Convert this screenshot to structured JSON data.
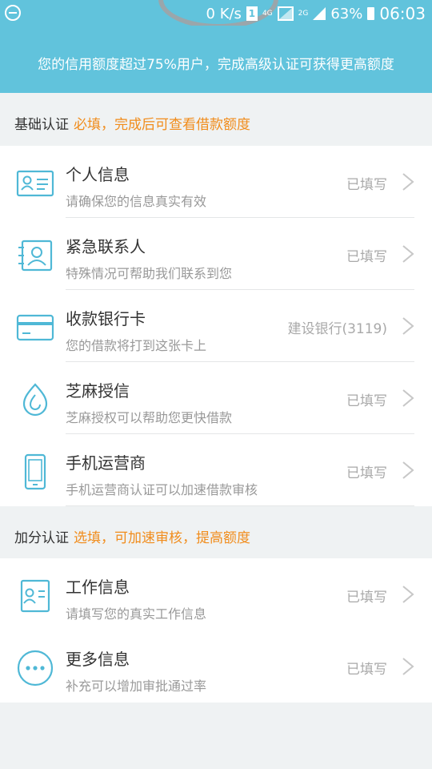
{
  "status_bar": {
    "speed": "0 K/s",
    "sim": "1",
    "network_4g": "4G",
    "network_2g": "2G",
    "battery": "63%",
    "time": "06:03"
  },
  "banner": {
    "text": "您的信用额度超过75%用户，完成高级认证可获得更高额度"
  },
  "basic_section": {
    "label": "基础认证",
    "hint": "必填，完成后可查看借款额度",
    "items": [
      {
        "title": "个人信息",
        "subtitle": "请确保您的信息真实有效",
        "status": "已填写",
        "icon": "id-card-icon"
      },
      {
        "title": "紧急联系人",
        "subtitle": "特殊情况可帮助我们联系到您",
        "status": "已填写",
        "icon": "contact-icon"
      },
      {
        "title": "收款银行卡",
        "subtitle": "您的借款将打到这张卡上",
        "status": "建设银行(3119)",
        "icon": "bank-card-icon"
      },
      {
        "title": "芝麻授信",
        "subtitle": "芝麻授权可以帮助您更快借款",
        "status": "已填写",
        "icon": "sesame-icon"
      },
      {
        "title": "手机运营商",
        "subtitle": "手机运营商认证可以加速借款审核",
        "status": "已填写",
        "icon": "mobile-phone-icon"
      }
    ]
  },
  "bonus_section": {
    "label": "加分认证",
    "hint": "选填，可加速审核，提高额度",
    "items": [
      {
        "title": "工作信息",
        "subtitle": "请填写您的真实工作信息",
        "status": "已填写",
        "icon": "work-info-icon"
      },
      {
        "title": "更多信息",
        "subtitle": "补充可以增加审批通过率",
        "status": "已填写",
        "icon": "more-info-icon"
      }
    ]
  },
  "colors": {
    "primary": "#61c3dc",
    "accent": "#f18c1b",
    "icon": "#4fb8d6"
  }
}
